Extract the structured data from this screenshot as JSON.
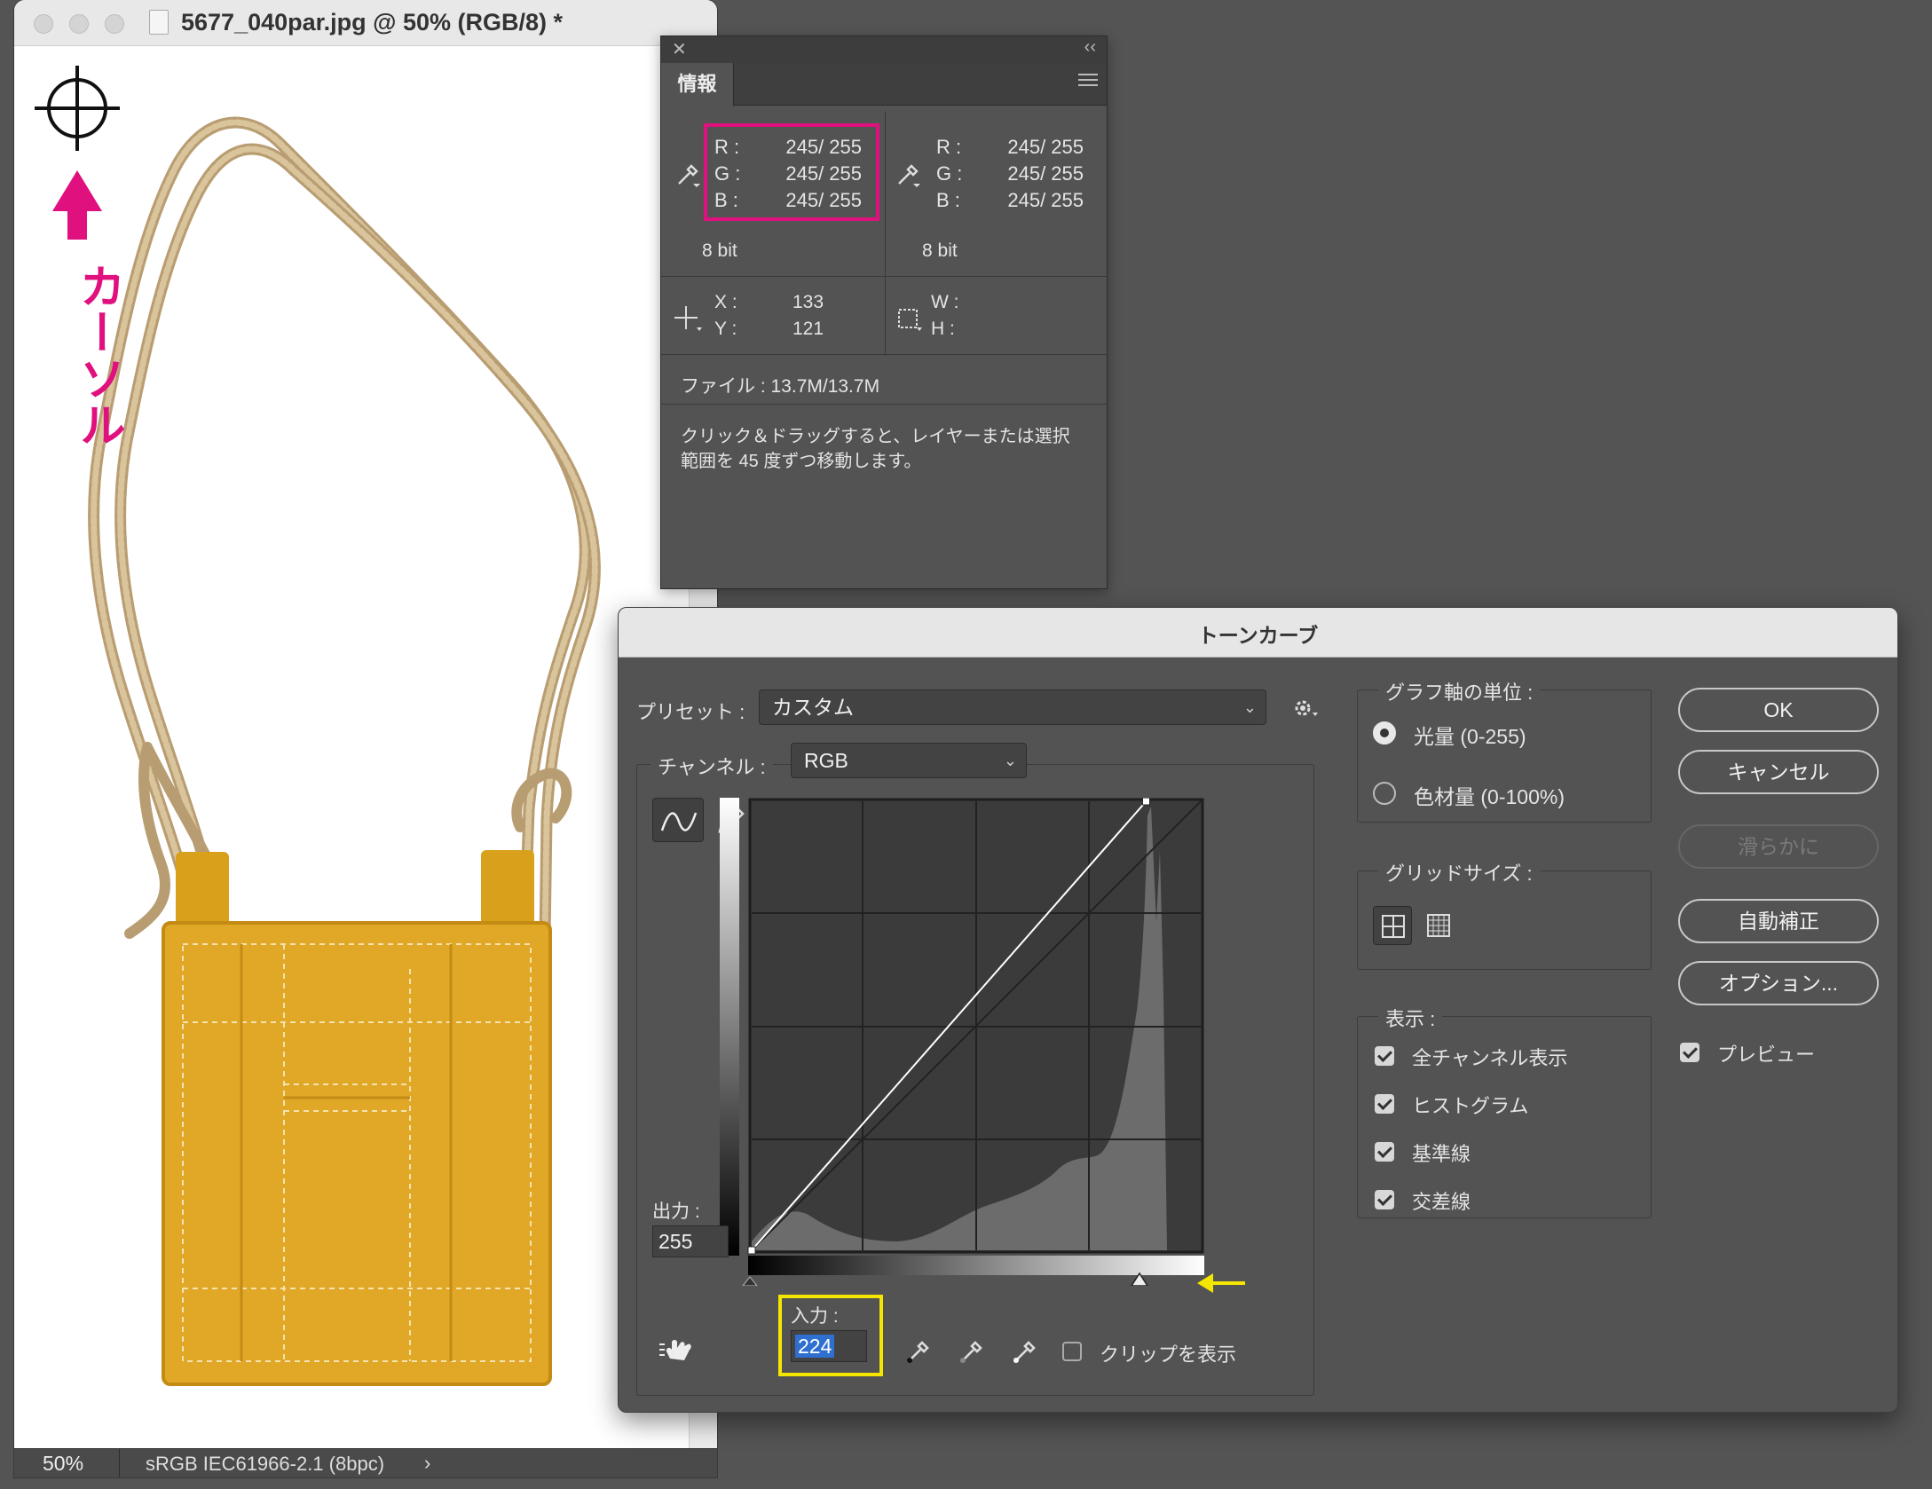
{
  "document": {
    "title": "5677_040par.jpg @ 50% (RGB/8) *",
    "zoom": "50%",
    "color_profile": "sRGB IEC61966-2.1 (8bpc)",
    "status_arrow": "›",
    "annotation_label": "カーソル"
  },
  "info_panel": {
    "tab": "情報",
    "sample1": {
      "r_label": "R :",
      "r": "245/ 255",
      "g_label": "G :",
      "g": "245/ 255",
      "b_label": "B :",
      "b": "245/ 255",
      "bits": "8 bit"
    },
    "sample2": {
      "r_label": "R :",
      "r": "245/ 255",
      "g_label": "G :",
      "g": "245/ 255",
      "b_label": "B :",
      "b": "245/ 255",
      "bits": "8 bit"
    },
    "x_label": "X :",
    "x": "133",
    "y_label": "Y :",
    "y": "121",
    "w_label": "W :",
    "h_label": "H :",
    "file": "ファイル : 13.7M/13.7M",
    "hint_line1": "クリック＆ドラッグすると、レイヤーまたは選択",
    "hint_line2": "範囲を 45 度ずつ移動します。",
    "highlight_color": "#e0107e"
  },
  "curves": {
    "title": "トーンカーブ",
    "preset_label": "プリセット :",
    "preset_value": "カスタム",
    "channel_label": "チャンネル :",
    "channel_value": "RGB",
    "output_label": "出力 :",
    "output_value": "255",
    "input_label": "入力 :",
    "input_value": "224",
    "show_clipping": "クリップを表示",
    "axis_group": "グラフ軸の単位 :",
    "axis_light": "光量 (0-255)",
    "axis_pigment": "色材量 (0-100%)",
    "grid_group": "グリッドサイズ :",
    "display_group": "表示 :",
    "show_all_channels": "全チャンネル表示",
    "show_histogram": "ヒストグラム",
    "show_baseline": "基準線",
    "show_intersection": "交差線",
    "buttons": {
      "ok": "OK",
      "cancel": "キャンセル",
      "smooth": "滑らかに",
      "auto": "自動補正",
      "options": "オプション..."
    },
    "preview": "プレビュー",
    "highlight_color": "#f5e600",
    "curve_points": [
      [
        0,
        0
      ],
      [
        224,
        255
      ]
    ]
  }
}
